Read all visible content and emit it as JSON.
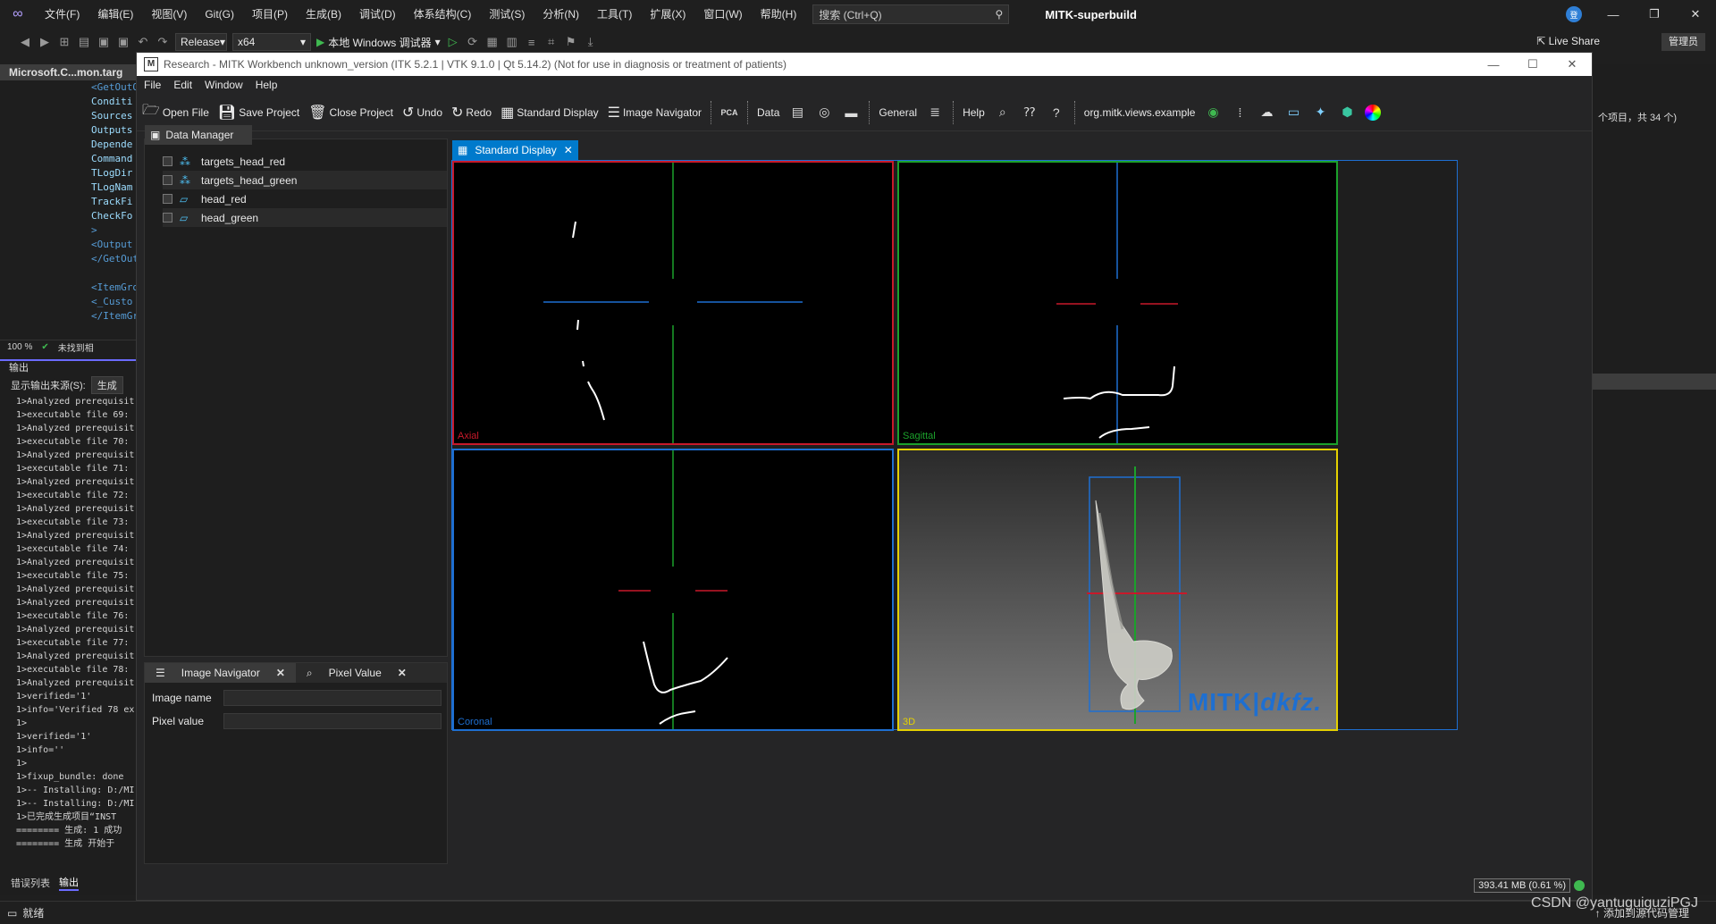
{
  "vs": {
    "menu": [
      "文件(F)",
      "编辑(E)",
      "视图(V)",
      "Git(G)",
      "项目(P)",
      "生成(B)",
      "调试(D)",
      "体系结构(C)",
      "测试(S)",
      "分析(N)",
      "工具(T)",
      "扩展(X)",
      "窗口(W)",
      "帮助(H)"
    ],
    "search_placeholder": "搜索 (Ctrl+Q)",
    "solution_name": "MITK-superbuild",
    "account_badge": "登",
    "config": "Release",
    "platform": "x64",
    "run_target": "本地 Windows 调试器",
    "live_share": "Live Share",
    "admin_badge": "管理员",
    "doc_tab": "Microsoft.C...mon.targ",
    "code_lines": [
      "<GetOutOf",
      "Conditi",
      "Sources",
      "Outputs",
      "Depende",
      "Command",
      "TLogDir",
      "TLogNam",
      "TrackFi",
      "CheckFo",
      ">",
      "<Output",
      "</GetOutO",
      "",
      "<ItemGrou",
      "<_Custo",
      "</ItemGro"
    ],
    "zoom": "100 %",
    "code_status": "未找到相",
    "output_title": "输出",
    "output_source_label": "显示输出来源(S):",
    "output_source_value": "生成",
    "output_lines": [
      "1>Analyzed prerequisit",
      "1>executable file 69:",
      "1>Analyzed prerequisit",
      "1>executable file 70:",
      "1>Analyzed prerequisit",
      "1>executable file 71:",
      "1>Analyzed prerequisit",
      "1>executable file 72:",
      "1>Analyzed prerequisit",
      "1>executable file 73:",
      "1>Analyzed prerequisit",
      "1>executable file 74:",
      "1>Analyzed prerequisit",
      "1>executable file 75:",
      "1>Analyzed prerequisit",
      "1>Analyzed prerequisit",
      "1>executable file 76:",
      "1>Analyzed prerequisit",
      "1>executable file 77:",
      "1>Analyzed prerequisit",
      "1>executable file 78:",
      "1>Analyzed prerequisit",
      "1>verified='1'",
      "1>info='Verified 78 ex",
      "1>",
      "1>verified='1'",
      "1>info=''",
      "1>",
      "1>fixup_bundle: done",
      "1>-- Installing: D:/MI",
      "1>-- Installing: D:/MI",
      "1>已完成生成项目“INST",
      "======== 生成: 1 成功",
      "======== 生成 开始于"
    ],
    "bottom_tabs": [
      "错误列表",
      "输出"
    ],
    "status_ready": "就绪",
    "status_right": "添加到源代码管理",
    "right_pane_text": "个项目，共 34 个)",
    "watermark": "CSDN @yantuguiguziPGJ"
  },
  "mitk": {
    "title": "Research - MITK Workbench unknown_version (ITK 5.2.1 | VTK 9.1.0 | Qt 5.14.2) (Not for use in diagnosis or treatment of patients)",
    "logo_letter": "M",
    "menu": [
      "File",
      "Edit",
      "Window",
      "Help"
    ],
    "toolbar": {
      "open_file": "Open File",
      "save_project": "Save Project",
      "close_project": "Close Project",
      "undo": "Undo",
      "redo": "Redo",
      "standard_display": "Standard Display",
      "image_navigator": "Image Navigator",
      "pca": "PCA",
      "data": "Data",
      "general": "General",
      "help": "Help",
      "example_view": "org.mitk.views.example"
    },
    "data_manager": {
      "tab": "Data Manager",
      "items": [
        {
          "name": "targets_head_red",
          "icon": "pointset-icon"
        },
        {
          "name": "targets_head_green",
          "icon": "pointset-icon"
        },
        {
          "name": "head_red",
          "icon": "surface-icon"
        },
        {
          "name": "head_green",
          "icon": "surface-icon"
        }
      ]
    },
    "navigator": {
      "tabs": [
        "Image Navigator",
        "Pixel Value"
      ],
      "image_name_label": "Image name",
      "pixel_value_label": "Pixel value"
    },
    "standard_display_tab": "Standard Display",
    "views": {
      "axial": "Axial",
      "sagittal": "Sagittal",
      "coronal": "Coronal",
      "threed": "3D"
    },
    "logo_mitk": "MITK",
    "logo_dkfz": "dkfz.",
    "memory": "393.41 MB (0.61 %)",
    "colors": {
      "axial": "#c8192a",
      "sagittal": "#1ba12b",
      "coronal": "#1e6fd1",
      "threed": "#e5d100"
    }
  }
}
